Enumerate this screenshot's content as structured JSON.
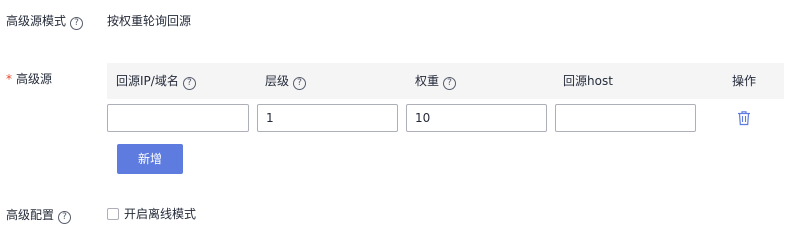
{
  "mode": {
    "label": "高级源模式",
    "value": "按权重轮询回源"
  },
  "advanced_source": {
    "required_mark": "*",
    "label": "高级源",
    "columns": [
      "回源IP/域名",
      "层级",
      "权重",
      "回源host",
      "操作"
    ],
    "row": {
      "ip_value": "",
      "level_value": "1",
      "weight_value": "10",
      "host_value": ""
    },
    "add_button": "新增"
  },
  "advanced_config": {
    "label": "高级配置",
    "checkbox_label": "开启离线模式"
  },
  "colors": {
    "primary": "#5e7ce0",
    "danger": "#e6492d",
    "header_bg": "#f5f5f6"
  }
}
